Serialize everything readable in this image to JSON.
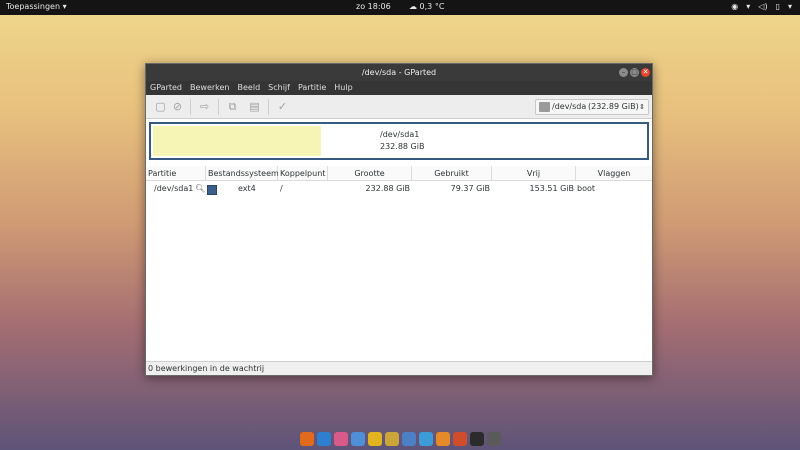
{
  "topbar": {
    "apps_label": "Toepassingen",
    "clock": "zo 18:06",
    "weather": "0,3 °C"
  },
  "window": {
    "title": "/dev/sda - GParted",
    "menu": [
      "GParted",
      "Bewerken",
      "Beeld",
      "Schijf",
      "Partitie",
      "Hulp"
    ],
    "device": {
      "name": "/dev/sda",
      "size": "(232.89 GiB)"
    },
    "graph": {
      "partition": "/dev/sda1",
      "size": "232.88 GiB"
    },
    "columns": [
      "Partitie",
      "Bestandssysteem",
      "Koppelpunt",
      "Grootte",
      "Gebruikt",
      "Vrij",
      "Vlaggen"
    ],
    "rows": [
      {
        "partition": "/dev/sda1",
        "filesystem": "ext4",
        "mountpoint": "/",
        "size": "232.88 GiB",
        "used": "79.37 GiB",
        "free": "153.51 GiB",
        "flags": "boot"
      }
    ],
    "status": "0 bewerkingen in de wachtrij"
  },
  "colors": {
    "accent": "#365a80",
    "used_fill": "#f7f5b6",
    "fs_swatch": "#3b5f8a"
  }
}
